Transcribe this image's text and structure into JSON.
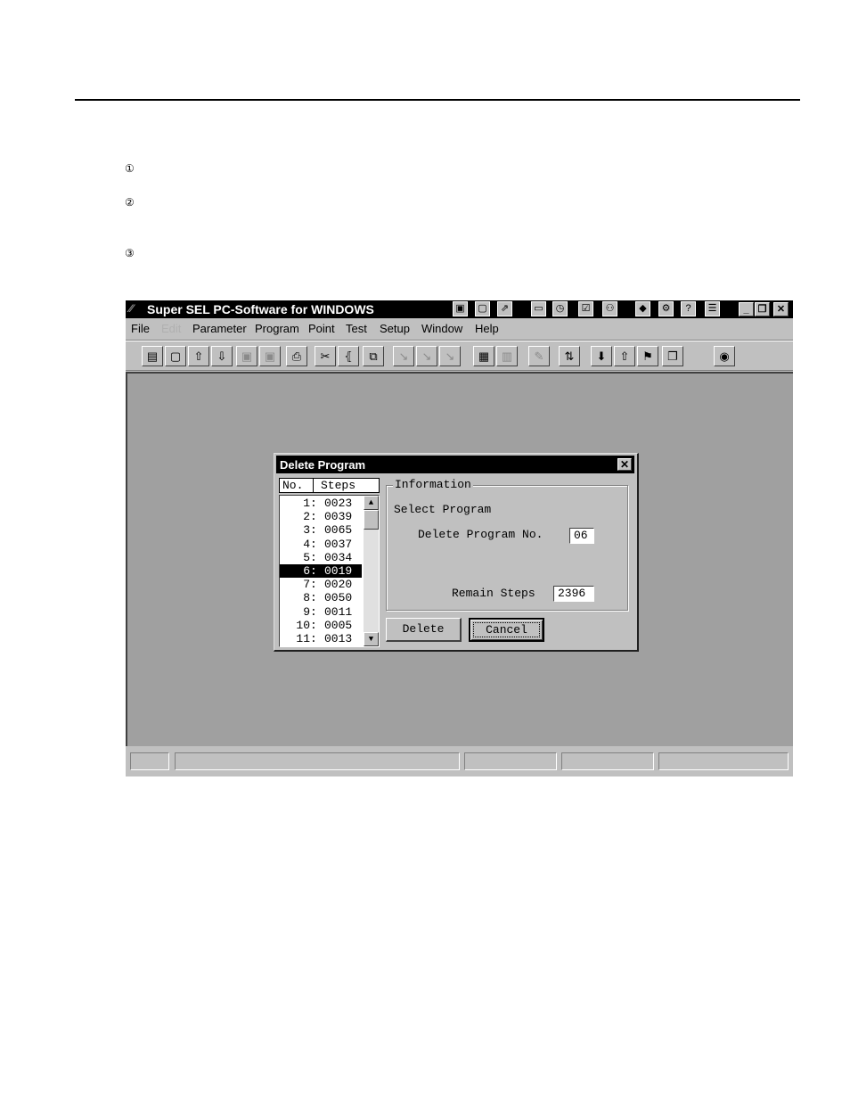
{
  "doc": {
    "steps": [
      "①",
      "②",
      "③"
    ]
  },
  "app": {
    "title": "Super SEL PC-Software for WINDOWS",
    "titlebar_icons": [
      "panel-icon",
      "page-icon",
      "export-icon",
      "card-icon",
      "clock-icon",
      "check-icon",
      "user-icon",
      "book-icon",
      "gear-icon",
      "help-icon",
      "manual-icon"
    ],
    "window_controls": {
      "minimize": "_",
      "restore": "❐",
      "close": "✕"
    },
    "menu": [
      "File",
      "Edit",
      "Parameter",
      "Program",
      "Point",
      "Test",
      "Setup",
      "Window",
      "Help"
    ],
    "menu_disabled": [
      "Edit"
    ],
    "toolbar": [
      {
        "name": "new-doc-icon",
        "glyph": "▤"
      },
      {
        "name": "new-doc-dotted-icon",
        "glyph": "▢"
      },
      {
        "name": "upload-icon",
        "glyph": "⇧"
      },
      {
        "name": "download-icon",
        "glyph": "⇩"
      },
      {
        "name": "copy-disabled-icon",
        "glyph": "▣"
      },
      {
        "name": "paste-disabled-icon",
        "glyph": "▣"
      },
      {
        "name": "print-icon",
        "glyph": "⎙"
      },
      {
        "name": "cut-icon",
        "glyph": "✂"
      },
      {
        "name": "bracket-icon",
        "glyph": "⦃"
      },
      {
        "name": "copy-icon",
        "glyph": "⧉"
      },
      {
        "name": "step-1-icon",
        "glyph": "↘"
      },
      {
        "name": "step-2-icon",
        "glyph": "↘"
      },
      {
        "name": "step-3-icon",
        "glyph": "↘"
      },
      {
        "name": "clipboard-icon",
        "glyph": "▦"
      },
      {
        "name": "doc-stack-icon",
        "glyph": "▥"
      },
      {
        "name": "pencil-icon",
        "glyph": "✎"
      },
      {
        "name": "sort-icon",
        "glyph": "⇅"
      },
      {
        "name": "arrow-down-icon",
        "glyph": "⬇"
      },
      {
        "name": "arrow-up-icon",
        "glyph": "⇧"
      },
      {
        "name": "flag-icon",
        "glyph": "⚑"
      },
      {
        "name": "window-icon",
        "glyph": "❐"
      },
      {
        "name": "record-icon",
        "glyph": "◉"
      }
    ]
  },
  "dialog": {
    "title": "Delete Program",
    "close_glyph": "✕",
    "list_headers": {
      "no": "No.",
      "steps": "Steps"
    },
    "programs": [
      {
        "no": "1",
        "steps": "0023"
      },
      {
        "no": "2",
        "steps": "0039"
      },
      {
        "no": "3",
        "steps": "0065"
      },
      {
        "no": "4",
        "steps": "0037"
      },
      {
        "no": "5",
        "steps": "0034"
      },
      {
        "no": "6",
        "steps": "0019"
      },
      {
        "no": "7",
        "steps": "0020"
      },
      {
        "no": "8",
        "steps": "0050"
      },
      {
        "no": "9",
        "steps": "0011"
      },
      {
        "no": "10",
        "steps": "0005"
      },
      {
        "no": "11",
        "steps": "0013"
      }
    ],
    "selected_program": "6",
    "info_group": "Information",
    "select_prompt": "Select Program",
    "delete_no_label": "Delete Program No.",
    "delete_no_value": "06",
    "remain_label": "Remain Steps",
    "remain_value": "2396",
    "delete_button": "Delete",
    "cancel_button": "Cancel"
  }
}
